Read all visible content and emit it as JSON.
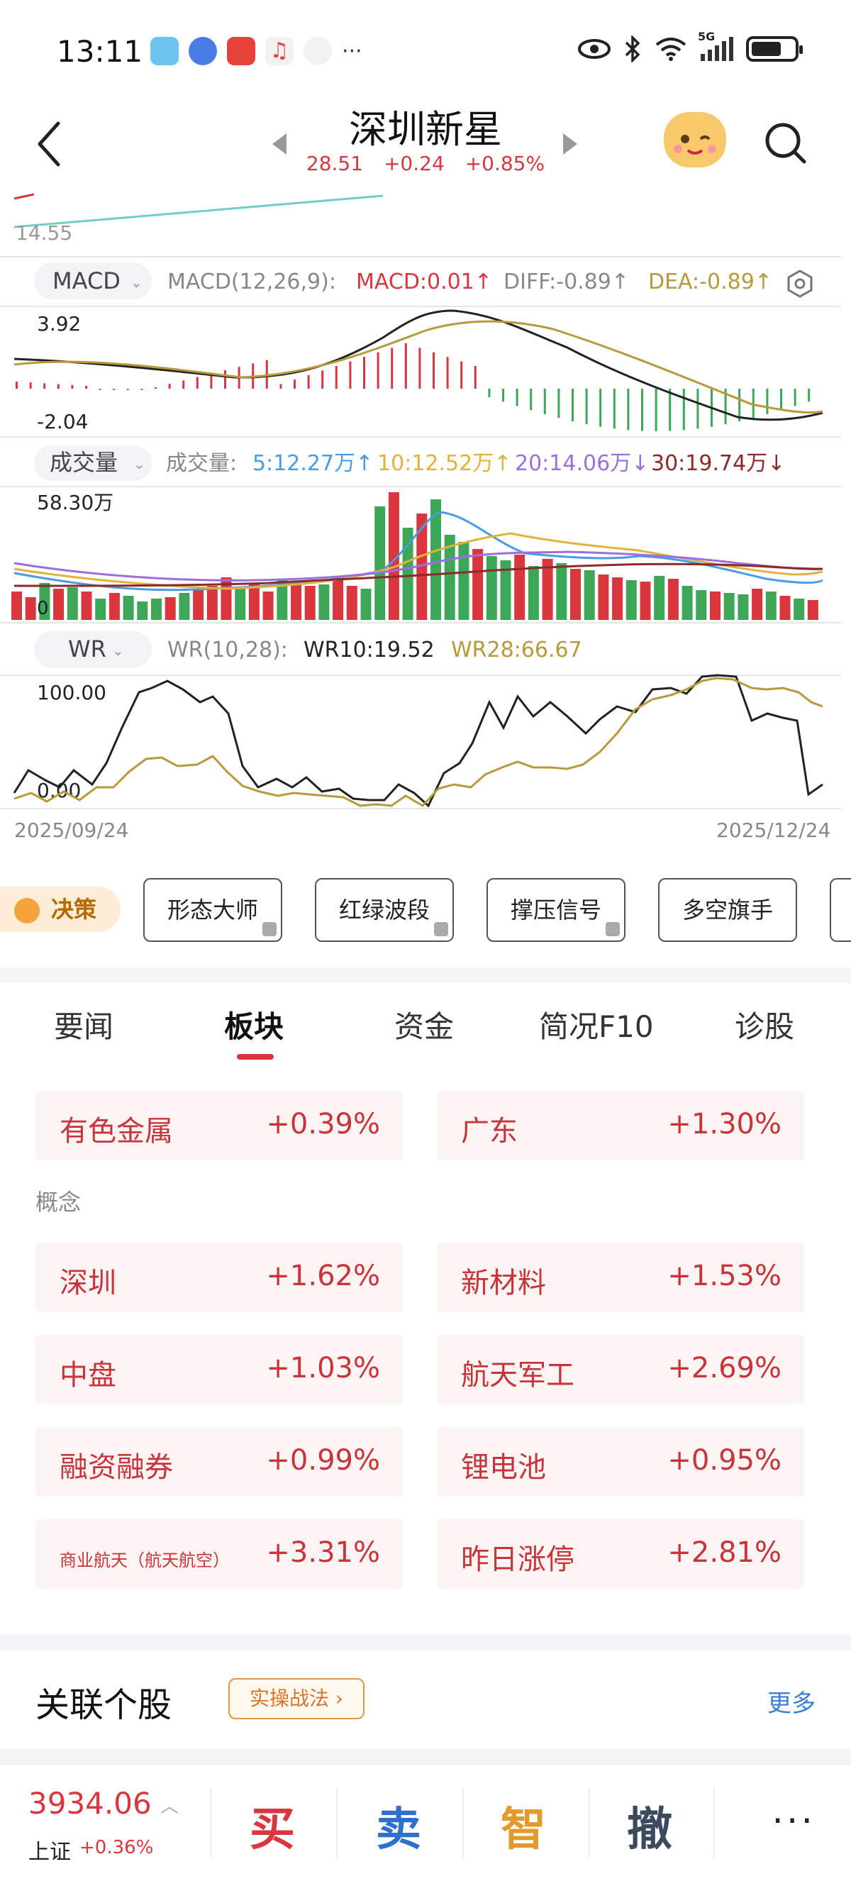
{
  "status": {
    "time": "13:11",
    "network": "5G"
  },
  "header": {
    "title": "深圳新星",
    "price": "28.51",
    "change": "+0.24",
    "change_pct": "+0.85%"
  },
  "chart": {
    "price_low_label": "14.55",
    "macd": {
      "selector": "MACD",
      "params": "MACD(12,26,9):",
      "macd": "MACD:0.01↑",
      "diff": "DIFF:-0.89↑",
      "dea": "DEA:-0.89↑",
      "ymax": "3.92",
      "ymin": "-2.04"
    },
    "volume": {
      "selector": "成交量",
      "prefix": "成交量:",
      "ma5": "5:12.27万↑",
      "ma10": "10:12.52万↑",
      "ma20": "20:14.06万↓",
      "ma30": "30:19.74万↓",
      "ymax": "58.30万",
      "ymin": "0"
    },
    "wr": {
      "selector": "WR",
      "params": "WR(10,28):",
      "wr10": "WR10:19.52",
      "wr28": "WR28:66.67",
      "ymax": "100.00",
      "ymin": "0.00"
    },
    "date_start": "2025/09/24",
    "date_end": "2025/12/24"
  },
  "strategy": {
    "badge": "决策",
    "buttons": [
      "形态大师",
      "红绿波段",
      "撑压信号",
      "多空旗手"
    ]
  },
  "tabs": [
    "要闻",
    "板块",
    "资金",
    "简况F10",
    "诊股"
  ],
  "sectors": {
    "industry": [
      {
        "name": "有色金属",
        "pct": "+0.39%"
      },
      {
        "name": "广东",
        "pct": "+1.30%"
      }
    ],
    "concept_label": "概念",
    "concepts": [
      {
        "name": "深圳",
        "pct": "+1.62%"
      },
      {
        "name": "新材料",
        "pct": "+1.53%"
      },
      {
        "name": "中盘",
        "pct": "+1.03%"
      },
      {
        "name": "航天军工",
        "pct": "+2.69%"
      },
      {
        "name": "融资融券",
        "pct": "+0.99%"
      },
      {
        "name": "锂电池",
        "pct": "+0.95%"
      },
      {
        "name": "商业航天（航天航空）",
        "pct": "+3.31%"
      },
      {
        "name": "昨日涨停",
        "pct": "+2.81%"
      }
    ]
  },
  "related": {
    "title": "关联个股",
    "tag": "实操战法 ›",
    "more": "更多"
  },
  "bottom": {
    "index_value": "3934.06",
    "index_name": "上证",
    "index_pct": "+0.36%",
    "buy": "买",
    "sell": "卖",
    "smart": "智",
    "cancel": "撤",
    "more": "···"
  },
  "colors": {
    "up": "#d9363e",
    "down": "#3ea657",
    "macd_diff": "#222222",
    "macd_dea": "#b89a3a",
    "ma5": "#4a9be6",
    "ma10": "#e0b43c",
    "ma20": "#9a6fe0",
    "ma30": "#8b2a2a"
  }
}
